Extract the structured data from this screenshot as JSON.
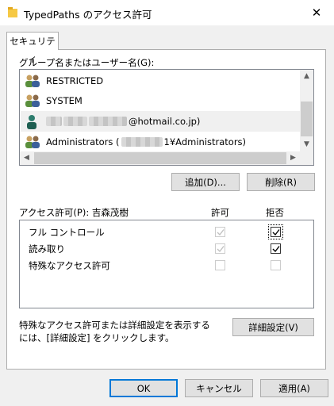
{
  "window": {
    "title": "TypedPaths のアクセス許可",
    "close_glyph": "✕"
  },
  "tab": {
    "label": "セキュリティ"
  },
  "groups": {
    "label": "グループ名またはユーザー名(G):",
    "items": [
      {
        "name": "RESTRICTED",
        "icon": "user-group-icon"
      },
      {
        "name": "SYSTEM",
        "icon": "user-group-icon"
      },
      {
        "name": "@hotmail.co.jp)",
        "icon": "user-icon",
        "selected": true
      },
      {
        "name": "Administrators (",
        "suffix": "1¥Administrators)",
        "icon": "user-group-icon"
      }
    ]
  },
  "buttons": {
    "add": "追加(D)...",
    "remove": "削除(R)",
    "advanced": "詳細設定(V)",
    "ok": "OK",
    "cancel": "キャンセル",
    "apply": "適用(A)"
  },
  "permissions": {
    "label": "アクセス許可(P): 吉森茂樹",
    "allow_header": "許可",
    "deny_header": "拒否",
    "rows": [
      {
        "name": "フル コントロール",
        "allow": true,
        "allow_enabled": false,
        "deny": true,
        "deny_enabled": true
      },
      {
        "name": "読み取り",
        "allow": true,
        "allow_enabled": false,
        "deny": true,
        "deny_enabled": true
      },
      {
        "name": "特殊なアクセス許可",
        "allow": false,
        "allow_enabled": false,
        "deny": false,
        "deny_enabled": false
      }
    ]
  },
  "hint": {
    "line1": "特殊なアクセス許可または詳細設定を表示する",
    "line2": "には、[詳細設定] をクリックします。"
  },
  "colors": {
    "accent": "#0078d7",
    "border": "#adadad",
    "button_bg": "#e1e1e1"
  }
}
